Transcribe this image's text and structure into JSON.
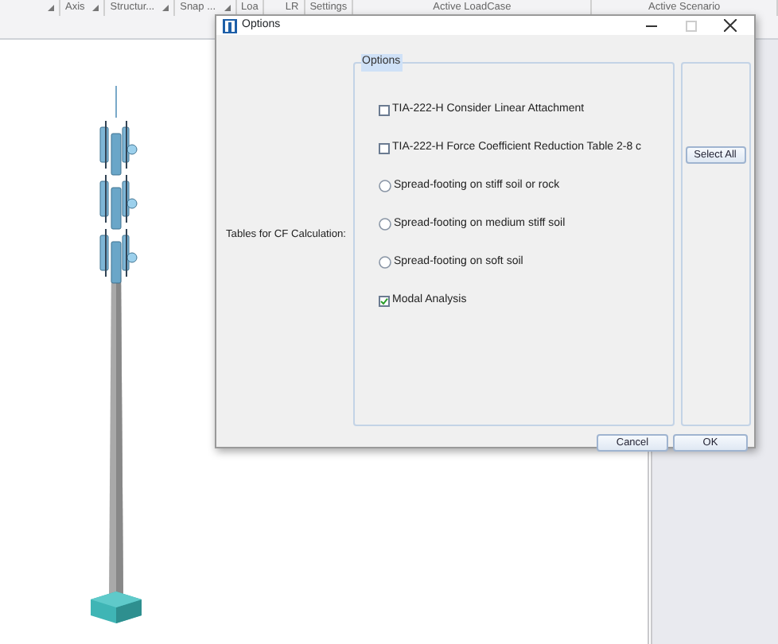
{
  "ribbon": {
    "groups": [
      {
        "launcher": true
      },
      {
        "label": "Axis",
        "launcher": true
      },
      {
        "label": "Structur...",
        "launcher": true
      },
      {
        "label": "Snap ...",
        "launcher": true
      },
      {
        "label": "Loa",
        "launcher": false
      },
      {
        "label": "LR",
        "launcher": false
      },
      {
        "label": "Settings",
        "launcher": false
      },
      {
        "label": "Active LoadCase",
        "launcher": false
      },
      {
        "label": "Active Scenario",
        "launcher": false
      }
    ]
  },
  "canvas": {
    "kind": "tower"
  },
  "dialog": {
    "title": "Options",
    "side_label": "Tables for CF Calculation:",
    "group_title": "Options",
    "options": [
      {
        "kind": "checkbox",
        "label": "TIA-222-H Consider Linear Attachment",
        "checked": false
      },
      {
        "kind": "checkbox",
        "label": "TIA-222-H Force Coefficient Reduction Table 2-8 c",
        "checked": false
      },
      {
        "kind": "radio",
        "label": "Spread-footing on stiff soil or rock",
        "checked": false
      },
      {
        "kind": "radio",
        "label": "Spread-footing on medium stiff soil",
        "checked": false
      },
      {
        "kind": "radio",
        "label": "Spread-footing on soft soil",
        "checked": false
      },
      {
        "kind": "checkbox",
        "label": "Modal Analysis",
        "checked": true
      }
    ],
    "side_button": "Select All",
    "buttons": [
      "Cancel",
      "OK"
    ]
  }
}
